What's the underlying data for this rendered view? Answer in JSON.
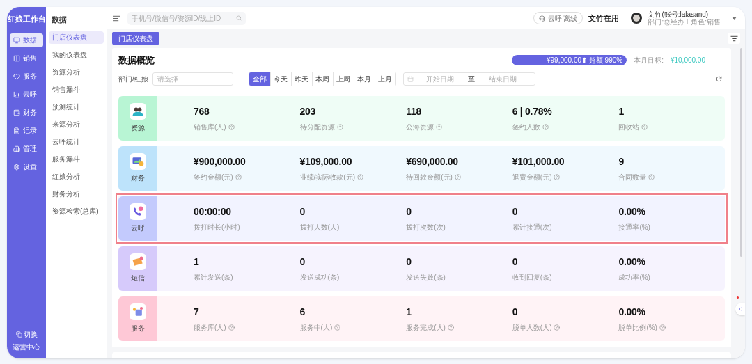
{
  "brand": "红娘工作台",
  "nav": [
    {
      "label": "数据",
      "selected": true
    },
    {
      "label": "销售",
      "selected": false
    },
    {
      "label": "服务",
      "selected": false
    },
    {
      "label": "云呼",
      "selected": false
    },
    {
      "label": "财务",
      "selected": false
    },
    {
      "label": "记录",
      "selected": false
    },
    {
      "label": "管理",
      "selected": false
    },
    {
      "label": "设置",
      "selected": false
    }
  ],
  "switch": {
    "line1": "切换",
    "line2": "运营中心"
  },
  "submenu": {
    "title": "数据",
    "items": [
      {
        "label": "门店仪表盘",
        "selected": true
      },
      {
        "label": "我的仪表盘",
        "selected": false
      },
      {
        "label": "资源分析",
        "selected": false
      },
      {
        "label": "销售漏斗",
        "selected": false
      },
      {
        "label": "预测统计",
        "selected": false
      },
      {
        "label": "来源分析",
        "selected": false
      },
      {
        "label": "云呼统计",
        "selected": false
      },
      {
        "label": "服务漏斗",
        "selected": false
      },
      {
        "label": "红娘分析",
        "selected": false
      },
      {
        "label": "财务分析",
        "selected": false
      },
      {
        "label": "资源检索(总库)",
        "selected": false
      }
    ]
  },
  "search": {
    "placeholder": "手机号/微信号/资源ID/线上ID"
  },
  "call_status": "云呼 离线",
  "in_use": "文竹在用",
  "user": {
    "name": "文竹(账号:lalasand)",
    "dept": "部门:总经办",
    "role": "角色:销售"
  },
  "page_tab": "门店仪表盘",
  "overview": {
    "title": "数据概览",
    "progress": {
      "text": "¥99,000.00⬆ 超额 990%",
      "level": 1
    },
    "target_label": "本月目标:",
    "target_value": "¥10,000.00",
    "filter_label": "部门/红娘",
    "filter_placeholder": "请选择",
    "periods": [
      {
        "label": "全部",
        "selected": true
      },
      {
        "label": "今天",
        "selected": false
      },
      {
        "label": "昨天",
        "selected": false
      },
      {
        "label": "本周",
        "selected": false
      },
      {
        "label": "上周",
        "selected": false
      },
      {
        "label": "本月",
        "selected": false
      },
      {
        "label": "上月",
        "selected": false
      }
    ],
    "date_start": "开始日期",
    "date_sep": "至",
    "date_end": "结束日期"
  },
  "groups": [
    {
      "name": "资源",
      "kind": "people",
      "color": "#b8f5d4",
      "highlighted": false,
      "stats": [
        {
          "value": "768",
          "label": "销售库(人)",
          "help": true
        },
        {
          "value": "203",
          "label": "待分配资源",
          "help": true
        },
        {
          "value": "118",
          "label": "公海资源",
          "help": true
        },
        {
          "value": "6 | 0.78%",
          "label": "签约人数",
          "help": true
        },
        {
          "value": "1",
          "label": "回收站",
          "help": true
        }
      ]
    },
    {
      "name": "财务",
      "kind": "finance",
      "color": "#bde3fb",
      "highlighted": false,
      "stats": [
        {
          "value": "¥900,000.00",
          "label": "签约金额(元)",
          "help": true
        },
        {
          "value": "¥109,000.00",
          "label": "业绩/实际收款(元)",
          "help": true
        },
        {
          "value": "¥690,000.00",
          "label": "待回款金额(元)",
          "help": true
        },
        {
          "value": "¥101,000.00",
          "label": "退费金额(元)",
          "help": true
        },
        {
          "value": "9",
          "label": "合同数量",
          "help": true
        }
      ]
    },
    {
      "name": "云呼",
      "kind": "phone",
      "color": "#c3cafd",
      "highlighted": true,
      "stats": [
        {
          "value": "00:00:00",
          "label": "拨打时长(小时)",
          "help": false
        },
        {
          "value": "0",
          "label": "拨打人数(人)",
          "help": false
        },
        {
          "value": "0",
          "label": "拨打次数(次)",
          "help": false
        },
        {
          "value": "0",
          "label": "累计接通(次)",
          "help": false
        },
        {
          "value": "0.00%",
          "label": "接通率(%)",
          "help": false
        }
      ]
    },
    {
      "name": "短信",
      "kind": "message",
      "color": "#d6cafb",
      "highlighted": false,
      "stats": [
        {
          "value": "1",
          "label": "累计发送(条)",
          "help": false
        },
        {
          "value": "0",
          "label": "发送成功(条)",
          "help": false
        },
        {
          "value": "0",
          "label": "发送失败(条)",
          "help": false
        },
        {
          "value": "0",
          "label": "收到回复(条)",
          "help": false
        },
        {
          "value": "0.00%",
          "label": "成功率(%)",
          "help": false
        }
      ]
    },
    {
      "name": "服务",
      "kind": "service",
      "color": "#fec8d6",
      "highlighted": false,
      "stats": [
        {
          "value": "7",
          "label": "服务库(人)",
          "help": true
        },
        {
          "value": "6",
          "label": "服务中(人)",
          "help": true
        },
        {
          "value": "1",
          "label": "服务完成(人)",
          "help": true
        },
        {
          "value": "0",
          "label": "脱单人数(人)",
          "help": true
        },
        {
          "value": "0.00%",
          "label": "脱单比例(%)",
          "help": true
        }
      ]
    }
  ]
}
